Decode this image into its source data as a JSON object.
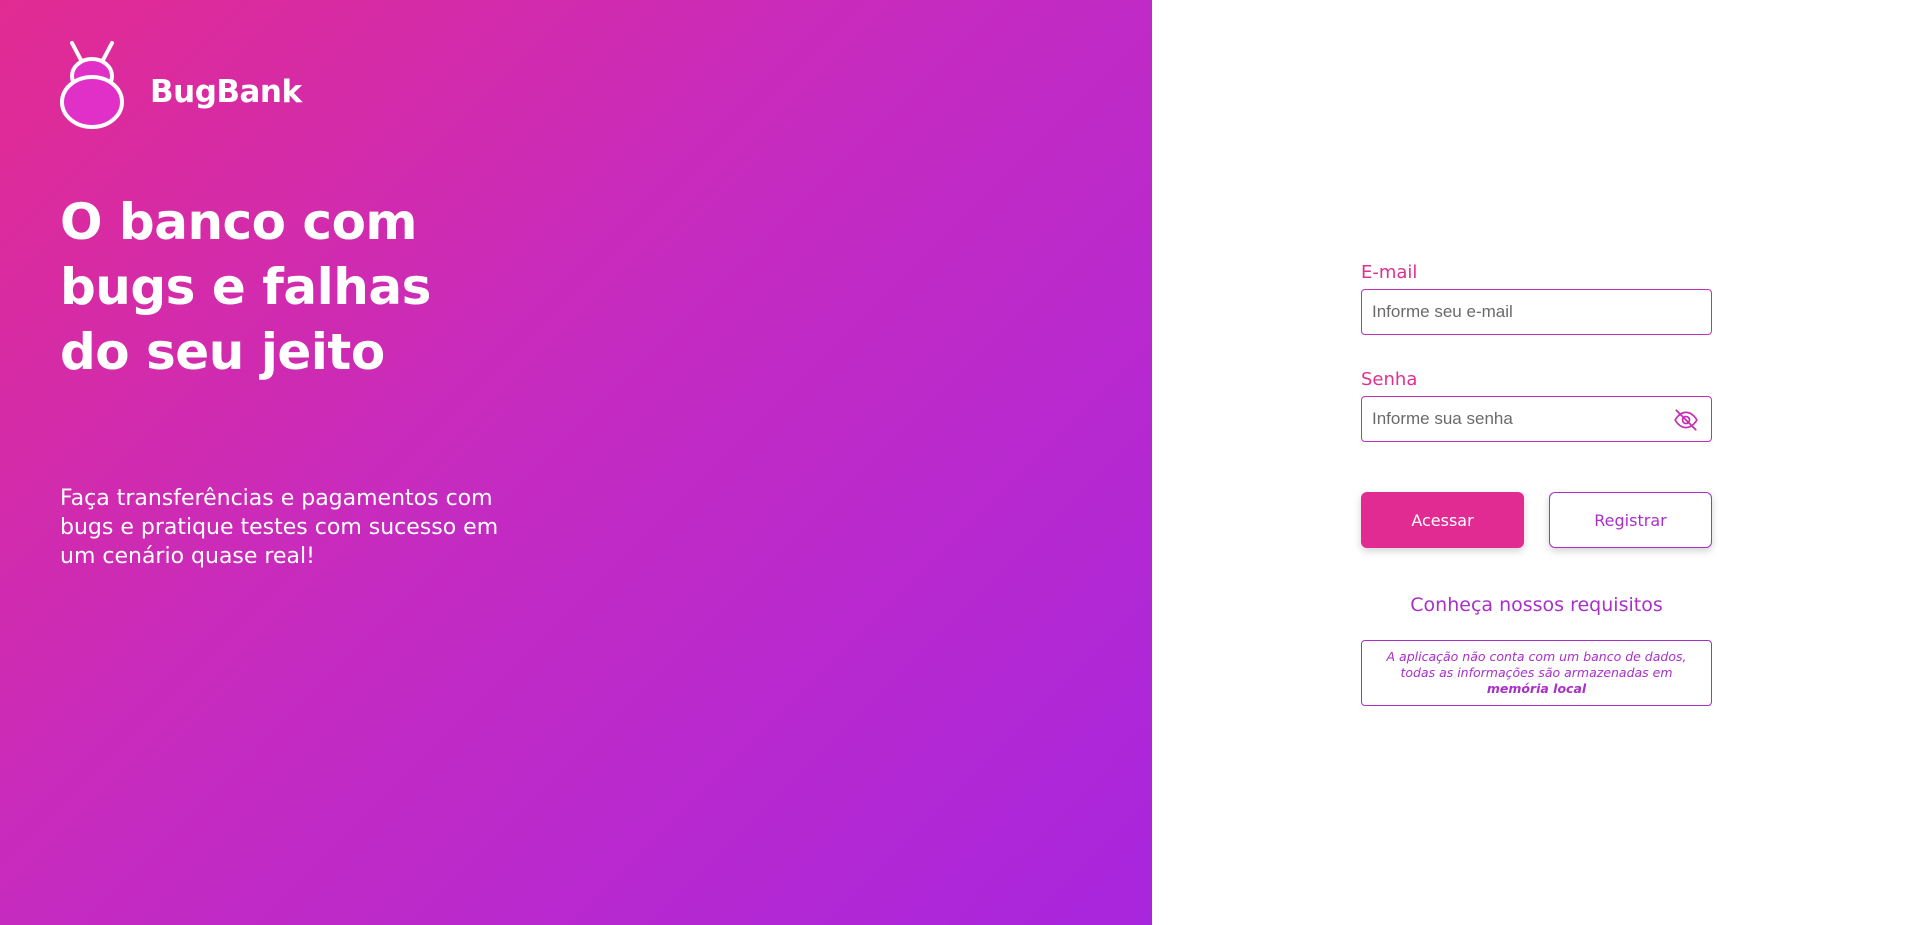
{
  "brand": {
    "name": "BugBank",
    "logo_icon": "bug-icon"
  },
  "hero": {
    "headline": [
      "O banco com",
      "bugs e falhas",
      "do seu jeito"
    ],
    "subtext": "Faça transferências e pagamentos com bugs e pratique testes com sucesso em um cenário quase real!"
  },
  "login": {
    "email_label": "E-mail",
    "email_placeholder": "Informe seu e-mail",
    "email_value": "",
    "password_label": "Senha",
    "password_placeholder": "Informe sua senha",
    "password_value": "",
    "password_toggle_icon": "eye-off-icon",
    "submit_label": "Acessar",
    "register_label": "Registrar",
    "requirements_link": "Conheça nossos requisitos",
    "notice_text": "A aplicação não conta com um banco de dados, todas as informações são armazenadas em ",
    "notice_emphasis": "memória local"
  },
  "colors": {
    "gradient_start": "#e22b92",
    "gradient_end": "#a826de",
    "primary": "#e22b92",
    "accent": "#a92fc9"
  }
}
